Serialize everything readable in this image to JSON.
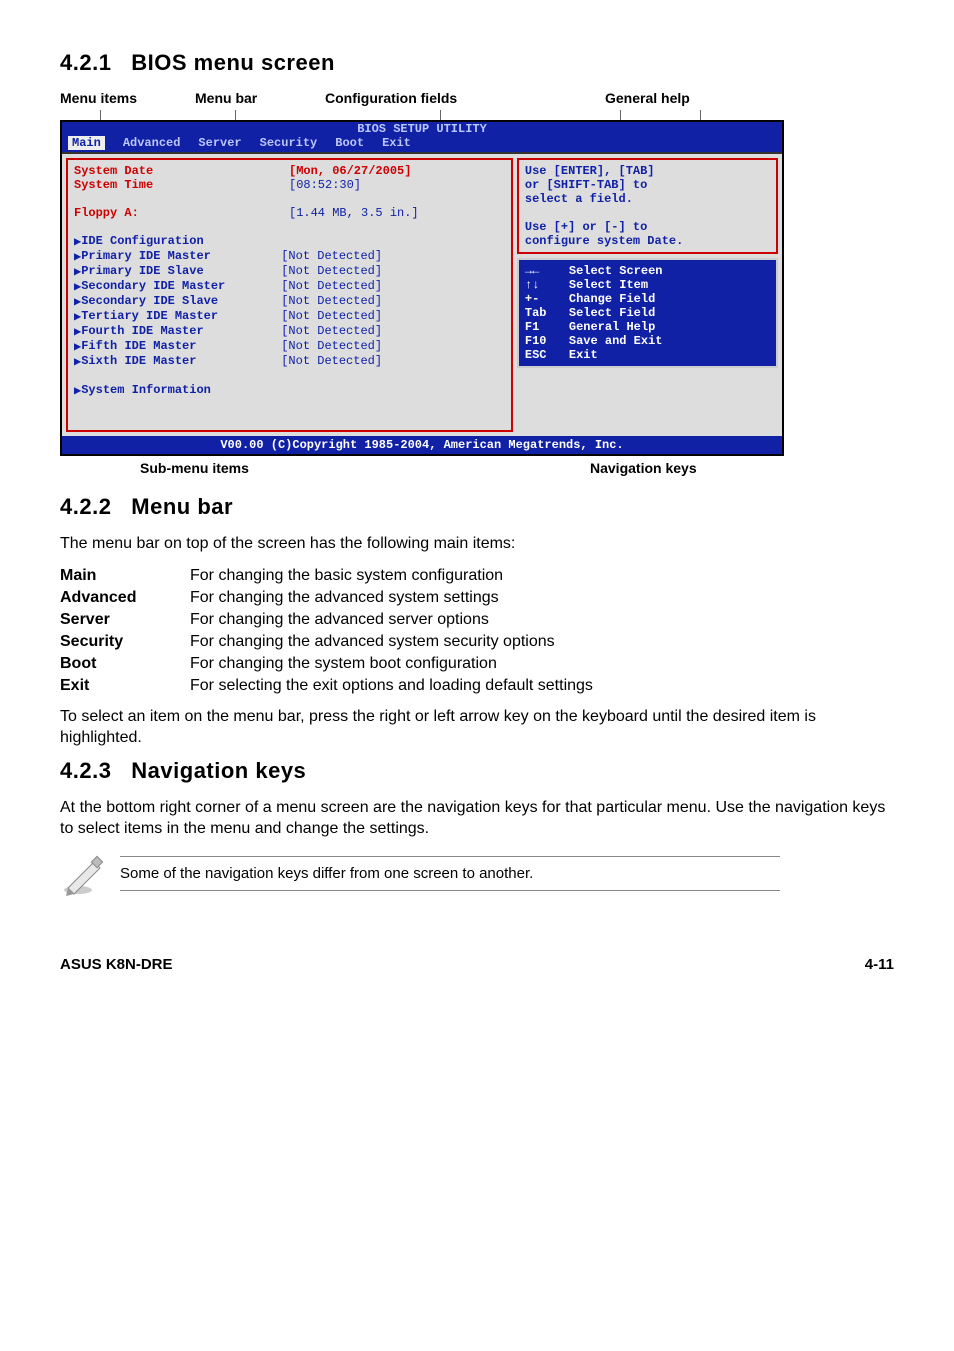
{
  "sections": {
    "s1": {
      "num": "4.2.1",
      "title": "BIOS menu screen"
    },
    "s2": {
      "num": "4.2.2",
      "title": "Menu bar"
    },
    "s3": {
      "num": "4.2.3",
      "title": "Navigation keys"
    }
  },
  "top_labels": {
    "menu_items": "Menu items",
    "menu_bar": "Menu bar",
    "config_fields": "Configuration fields",
    "general_help": "General help"
  },
  "bios": {
    "title": "BIOS SETUP UTILITY",
    "menu": [
      "Main",
      "Advanced",
      "Server",
      "Security",
      "Boot",
      "Exit"
    ],
    "left_rows": [
      {
        "key": "System Date",
        "val": "[Mon, 06/27/2005]"
      },
      {
        "key": "System Time",
        "val": "[08:52:30]"
      },
      {
        "key": "",
        "val": ""
      },
      {
        "key": "Floppy A:",
        "val": "[1.44 MB, 3.5 in.]"
      }
    ],
    "submenus": [
      {
        "key": "IDE Configuration",
        "val": ""
      },
      {
        "key": "Primary IDE Master",
        "val": "[Not Detected]"
      },
      {
        "key": "Primary IDE Slave",
        "val": "[Not Detected]"
      },
      {
        "key": "Secondary IDE Master",
        "val": "[Not Detected]"
      },
      {
        "key": "Secondary IDE Slave",
        "val": "[Not Detected]"
      },
      {
        "key": "Tertiary IDE Master",
        "val": "[Not Detected]"
      },
      {
        "key": "Fourth IDE Master",
        "val": "[Not Detected]"
      },
      {
        "key": "Fifth IDE Master",
        "val": "[Not Detected]"
      },
      {
        "key": "Sixth IDE Master",
        "val": "[Not Detected]"
      }
    ],
    "sysinfo": "System Information",
    "help": {
      "l1": "Use [ENTER], [TAB]",
      "l2": "or [SHIFT-TAB] to",
      "l3": "select a field.",
      "l4": "Use [+] or [-] to",
      "l5": "configure system Date."
    },
    "nav": [
      {
        "k": "→←",
        "v": "Select Screen"
      },
      {
        "k": "↑↓",
        "v": "Select Item"
      },
      {
        "k": "+-",
        "v": "Change Field"
      },
      {
        "k": "Tab",
        "v": "Select Field"
      },
      {
        "k": "F1",
        "v": "General Help"
      },
      {
        "k": "F10",
        "v": "Save and Exit"
      },
      {
        "k": "ESC",
        "v": "Exit"
      }
    ],
    "copy": "V00.00 (C)Copyright 1985-2004, American Megatrends, Inc."
  },
  "sub_labels": {
    "submenu": "Sub-menu items",
    "navkeys": "Navigation keys"
  },
  "menubar_intro": "The menu bar on top of the screen has the following main items:",
  "defs": [
    {
      "term": "Main",
      "desc": "For changing the basic system configuration"
    },
    {
      "term": "Advanced",
      "desc": "For changing the advanced system settings"
    },
    {
      "term": "Server",
      "desc": "For changing the advanced server options"
    },
    {
      "term": "Security",
      "desc": "For changing the advanced system security options"
    },
    {
      "term": "Boot",
      "desc": "For changing the system boot configuration"
    },
    {
      "term": "Exit",
      "desc": "For selecting the exit options and loading default settings"
    }
  ],
  "menubar_outro": "To select an item on the menu bar, press the right or left arrow key on the keyboard until the desired item is highlighted.",
  "navkeys_para": "At the bottom right corner of a menu screen are the navigation keys for that particular menu. Use the navigation keys to select items in the menu and change the settings.",
  "note": "Some of the navigation keys differ from one screen to another.",
  "footer": {
    "left": "ASUS K8N-DRE",
    "right": "4-11"
  }
}
